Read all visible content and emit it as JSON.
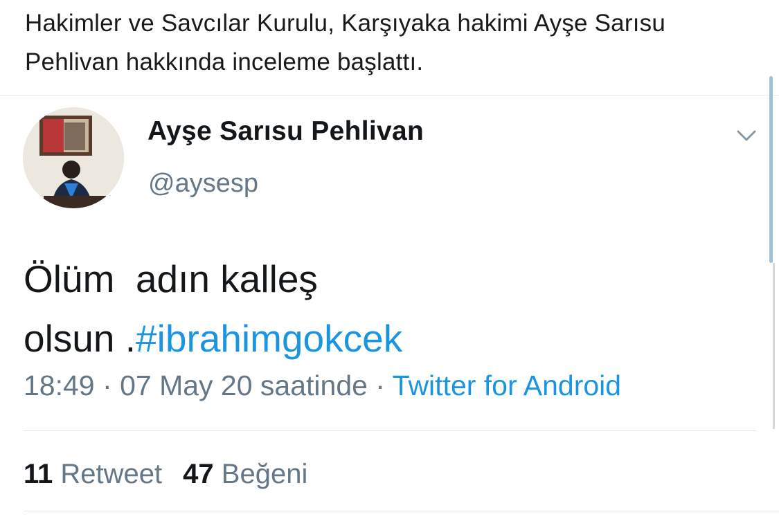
{
  "headline": {
    "text": "Hakimler ve Savcılar Kurulu, Karşıyaka hakimi Ayşe Sarısu Pehlivan hakkında inceleme başlattı."
  },
  "tweet": {
    "author_name": "Ayşe Sarısu Pehlivan",
    "author_handle": "@aysesp",
    "text_line1": "Ölüm  adın kalleş",
    "text_line2_prefix": "olsun .",
    "hashtag": "#ibrahimgokcek",
    "time": "18:49",
    "separator": "·",
    "date": "07 May 20 saatinde",
    "source": "Twitter for Android",
    "retweet_count": "11",
    "retweet_label": "Retweet",
    "like_count": "47",
    "like_label": "Beğeni"
  },
  "icons": {
    "caret": "chevron-down-icon",
    "avatar": "profile-photo"
  },
  "colors": {
    "link": "#1b95e0",
    "secondary_text": "#657786",
    "primary_text": "#14171a"
  }
}
